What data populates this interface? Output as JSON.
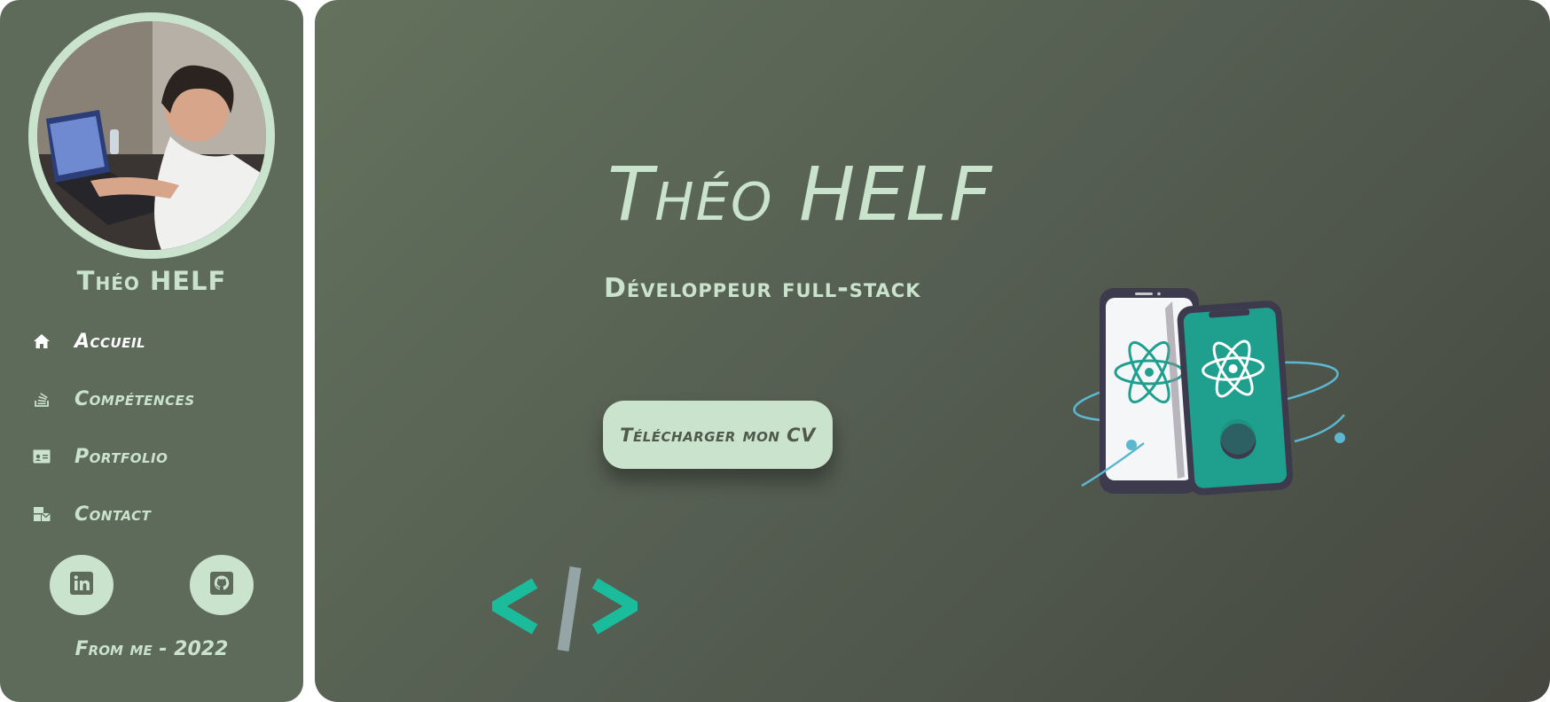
{
  "profile": {
    "name": "Théo HELF",
    "avatar": "profile-photo"
  },
  "nav": {
    "items": [
      {
        "label": "Accueil",
        "icon": "home-icon",
        "active": true
      },
      {
        "label": "Compétences",
        "icon": "stack-icon",
        "active": false
      },
      {
        "label": "Portfolio",
        "icon": "id-card-icon",
        "active": false
      },
      {
        "label": "Contact",
        "icon": "mail-bulk-icon",
        "active": false
      }
    ]
  },
  "social": [
    {
      "name": "LinkedIn",
      "icon": "linkedin-icon"
    },
    {
      "name": "GitHub",
      "icon": "github-icon"
    }
  ],
  "footer": {
    "text": "From me - 2022"
  },
  "hero": {
    "title": "Théo HELF",
    "subtitle": "Développeur full-stack",
    "cv_button": "Télécharger mon CV"
  },
  "colors": {
    "sidebar_bg": "#5f6b5a",
    "accent": "#c9e3cc",
    "main_gradient_start": "#64725d",
    "main_gradient_end": "#45473f",
    "teal": "#1fa08f"
  }
}
